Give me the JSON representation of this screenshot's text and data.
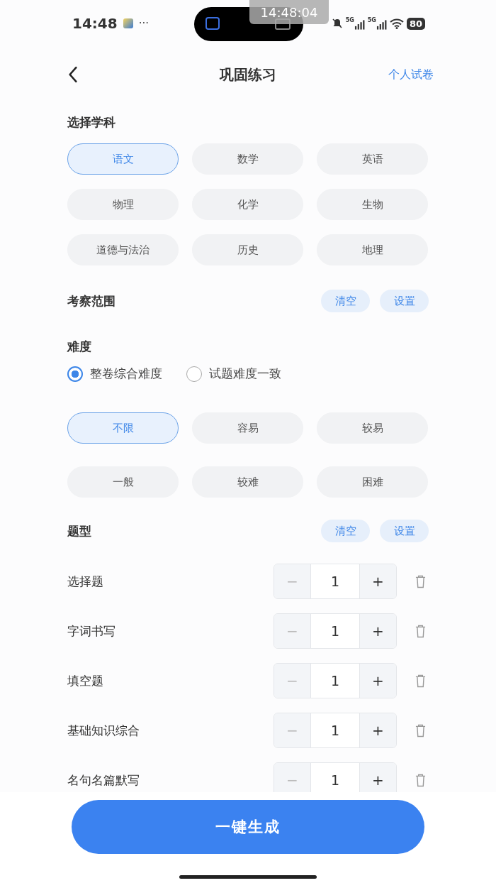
{
  "status_bar": {
    "time": "14:48",
    "more": "···",
    "overlay_time": "14:48:04",
    "network_1": "5G",
    "network_2": "5G",
    "battery": "80"
  },
  "nav": {
    "title": "巩固练习",
    "action": "个人试卷"
  },
  "subject": {
    "title": "选择学科",
    "options": [
      {
        "label": "语文",
        "selected": true
      },
      {
        "label": "数学",
        "selected": false
      },
      {
        "label": "英语",
        "selected": false
      },
      {
        "label": "物理",
        "selected": false
      },
      {
        "label": "化学",
        "selected": false
      },
      {
        "label": "生物",
        "selected": false
      },
      {
        "label": "道德与法治",
        "selected": false
      },
      {
        "label": "历史",
        "selected": false
      },
      {
        "label": "地理",
        "selected": false
      }
    ]
  },
  "scope": {
    "title": "考察范围",
    "buttons": [
      "清空",
      "设置"
    ]
  },
  "difficulty": {
    "title": "难度",
    "modes": [
      {
        "label": "整卷综合难度",
        "selected": true
      },
      {
        "label": "试题难度一致",
        "selected": false
      }
    ],
    "options": [
      {
        "label": "不限",
        "selected": true
      },
      {
        "label": "容易",
        "selected": false
      },
      {
        "label": "较易",
        "selected": false
      },
      {
        "label": "一般",
        "selected": false
      },
      {
        "label": "较难",
        "selected": false
      },
      {
        "label": "困难",
        "selected": false
      }
    ]
  },
  "question_types": {
    "title": "题型",
    "buttons": [
      "清空",
      "设置"
    ],
    "items": [
      {
        "name": "选择题",
        "count": "1",
        "minus": "−",
        "plus": "+"
      },
      {
        "name": "字词书写",
        "count": "1",
        "minus": "−",
        "plus": "+"
      },
      {
        "name": "填空题",
        "count": "1",
        "minus": "−",
        "plus": "+"
      },
      {
        "name": "基础知识综合",
        "count": "1",
        "minus": "−",
        "plus": "+"
      },
      {
        "name": "名句名篇默写",
        "count": "1",
        "minus": "−",
        "plus": "+"
      }
    ]
  },
  "generate_button": "一键生成"
}
